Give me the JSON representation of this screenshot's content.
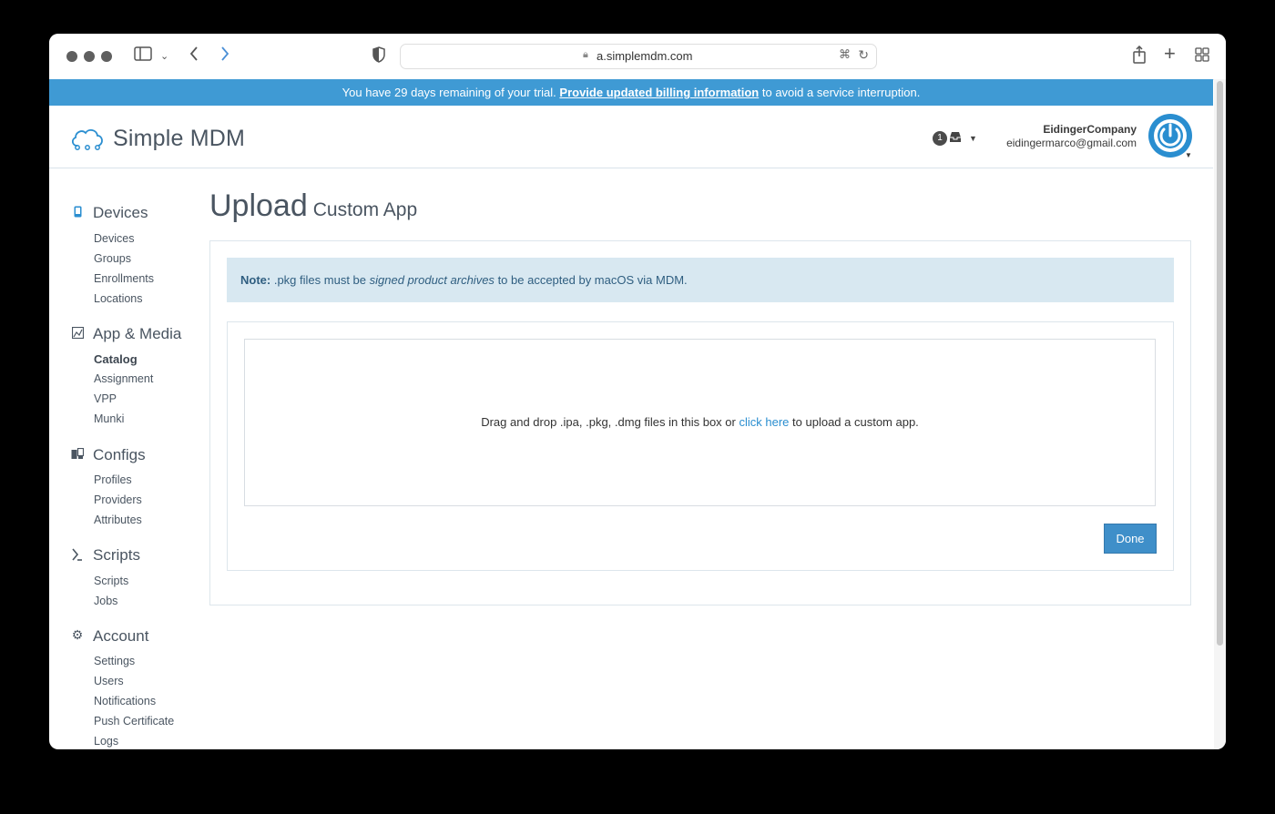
{
  "browser": {
    "url": "a.simplemdm.com"
  },
  "banner": {
    "text_before": "You have 29 days remaining of your trial.",
    "link": "Provide updated billing information",
    "text_after": "to avoid a service interruption."
  },
  "header": {
    "logo": "Simple MDM",
    "notification_count": "1",
    "company": "EidingerCompany",
    "email": "eidingermarco@gmail.com"
  },
  "sidebar": {
    "sections": [
      {
        "label": "Devices",
        "icon": "phone-icon",
        "items": [
          "Devices",
          "Groups",
          "Enrollments",
          "Locations"
        ]
      },
      {
        "label": "App & Media",
        "icon": "apps-icon",
        "items": [
          "Catalog",
          "Assignment",
          "VPP",
          "Munki"
        ],
        "active": "Catalog"
      },
      {
        "label": "Configs",
        "icon": "configs-icon",
        "items": [
          "Profiles",
          "Providers",
          "Attributes"
        ]
      },
      {
        "label": "Scripts",
        "icon": "scripts-icon",
        "items": [
          "Scripts",
          "Jobs"
        ]
      },
      {
        "label": "Account",
        "icon": "gear-icon",
        "items": [
          "Settings",
          "Users",
          "Notifications",
          "Push Certificate",
          "Logs"
        ]
      }
    ]
  },
  "main": {
    "title": "Upload",
    "subtitle": "Custom App",
    "note_label": "Note:",
    "note_text_1": ".pkg files must be",
    "note_italic": "signed product archives",
    "note_text_2": "to be accepted by macOS via MDM.",
    "drop_text_before": "Drag and drop .ipa, .pkg, .dmg files in this box or",
    "drop_link": "click here",
    "drop_text_after": "to upload a custom app.",
    "done_button": "Done"
  },
  "colors": {
    "banner": "#3f9ad4",
    "accent": "#2a8ed0",
    "note_bg": "#d8e8f1",
    "done_button": "#3f8fc9"
  }
}
